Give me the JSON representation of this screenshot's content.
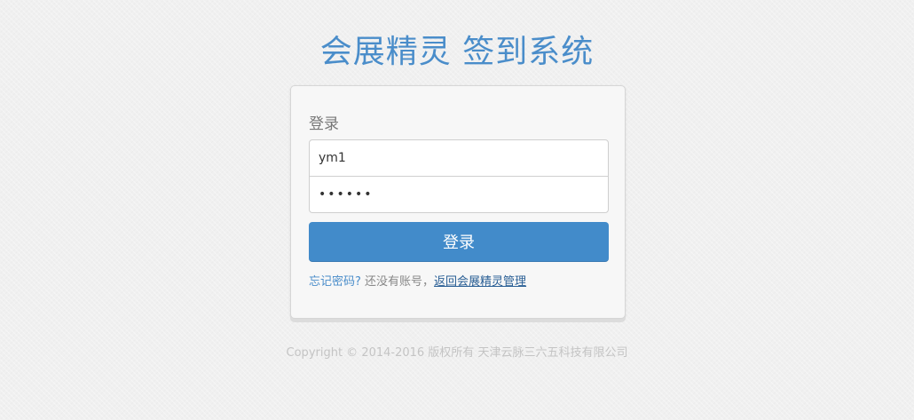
{
  "header": {
    "title": "会展精灵 签到系统"
  },
  "login": {
    "heading": "登录",
    "username_value": "ym1",
    "password_value": "123456",
    "submit_label": "登录",
    "forgot_link": "忘记密码?",
    "no_account_text": " 还没有账号，",
    "back_link": "返回会展精灵管理"
  },
  "footer": {
    "copyright": "Copyright © 2014-2016 版权所有 天津云脉三六五科技有限公司"
  },
  "colors": {
    "title": "#4a8dca",
    "button": "#428bca",
    "link": "#4a8dca"
  }
}
